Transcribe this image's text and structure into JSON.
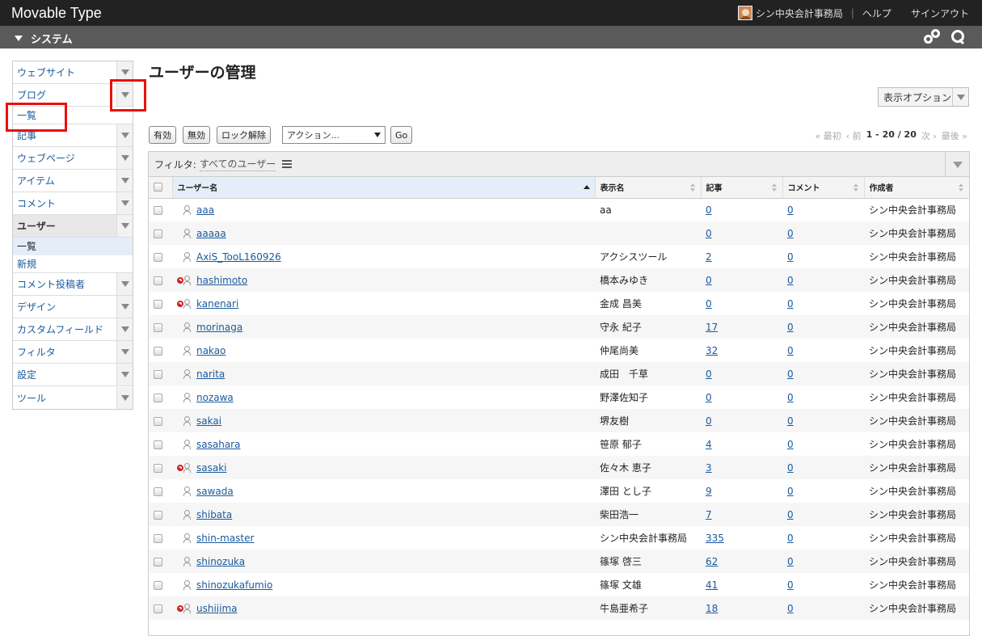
{
  "app": {
    "brand": "Movable Type"
  },
  "topnav": {
    "user": "シン中央会計事務局",
    "help": "ヘルプ",
    "signout": "サインアウト"
  },
  "scope": {
    "label": "システム"
  },
  "sidebar": {
    "items": [
      {
        "label": "ウェブサイト"
      },
      {
        "label": "ブログ"
      },
      {
        "label": "一覧"
      },
      {
        "label": "記事"
      },
      {
        "label": "ウェブページ"
      },
      {
        "label": "アイテム"
      },
      {
        "label": "コメント"
      },
      {
        "label": "ユーザー"
      },
      {
        "label": "一覧"
      },
      {
        "label": "新規"
      },
      {
        "label": "コメント投稿者"
      },
      {
        "label": "デザイン"
      },
      {
        "label": "カスタムフィールド"
      },
      {
        "label": "フィルタ"
      },
      {
        "label": "設定"
      },
      {
        "label": "ツール"
      }
    ]
  },
  "page": {
    "title": "ユーザーの管理",
    "display_options": "表示オプション"
  },
  "actions": {
    "enable": "有効",
    "disable": "無効",
    "unlock": "ロック解除",
    "action_select": "アクション...",
    "go": "Go"
  },
  "pager": {
    "first": "« 最初",
    "prev": "‹ 前",
    "range": "1 - 20 / 20",
    "next": "次 ›",
    "last": "最後 »"
  },
  "filter": {
    "label": "フィルタ:",
    "value": "すべてのユーザー"
  },
  "table": {
    "headers": {
      "username": "ユーザー名",
      "display": "表示名",
      "entries": "記事",
      "comments": "コメント",
      "author": "作成者"
    },
    "rows": [
      {
        "user": "aaa",
        "display": "aa",
        "entries": "0",
        "comments": "0",
        "author": "シン中央会計事務局",
        "disabled": false
      },
      {
        "user": "aaaaa",
        "display": "",
        "entries": "0",
        "comments": "0",
        "author": "シン中央会計事務局",
        "disabled": false
      },
      {
        "user": "AxiS_TooL160926",
        "display": "アクシスツール",
        "entries": "2",
        "comments": "0",
        "author": "シン中央会計事務局",
        "disabled": false
      },
      {
        "user": "hashimoto",
        "display": "橋本みゆき",
        "entries": "0",
        "comments": "0",
        "author": "シン中央会計事務局",
        "disabled": true
      },
      {
        "user": "kanenari",
        "display": "金成 昌美",
        "entries": "0",
        "comments": "0",
        "author": "シン中央会計事務局",
        "disabled": true
      },
      {
        "user": "morinaga",
        "display": "守永 紀子",
        "entries": "17",
        "comments": "0",
        "author": "シン中央会計事務局",
        "disabled": false
      },
      {
        "user": "nakao",
        "display": "仲尾尚美",
        "entries": "32",
        "comments": "0",
        "author": "シン中央会計事務局",
        "disabled": false
      },
      {
        "user": "narita",
        "display": "成田　千草",
        "entries": "0",
        "comments": "0",
        "author": "シン中央会計事務局",
        "disabled": false
      },
      {
        "user": "nozawa",
        "display": "野澤佐知子",
        "entries": "0",
        "comments": "0",
        "author": "シン中央会計事務局",
        "disabled": false
      },
      {
        "user": "sakai",
        "display": "堺友樹",
        "entries": "0",
        "comments": "0",
        "author": "シン中央会計事務局",
        "disabled": false
      },
      {
        "user": "sasahara",
        "display": "笹原 郁子",
        "entries": "4",
        "comments": "0",
        "author": "シン中央会計事務局",
        "disabled": false
      },
      {
        "user": "sasaki",
        "display": "佐々木 恵子",
        "entries": "3",
        "comments": "0",
        "author": "シン中央会計事務局",
        "disabled": true
      },
      {
        "user": "sawada",
        "display": "澤田 とし子",
        "entries": "9",
        "comments": "0",
        "author": "シン中央会計事務局",
        "disabled": false
      },
      {
        "user": "shibata",
        "display": "柴田浩一",
        "entries": "7",
        "comments": "0",
        "author": "シン中央会計事務局",
        "disabled": false
      },
      {
        "user": "shin-master",
        "display": "シン中央会計事務局",
        "entries": "335",
        "comments": "0",
        "author": "シン中央会計事務局",
        "disabled": false
      },
      {
        "user": "shinozuka",
        "display": "篠塚 啓三",
        "entries": "62",
        "comments": "0",
        "author": "シン中央会計事務局",
        "disabled": false
      },
      {
        "user": "shinozukafumio",
        "display": "篠塚 文雄",
        "entries": "41",
        "comments": "0",
        "author": "シン中央会計事務局",
        "disabled": false
      },
      {
        "user": "ushijima",
        "display": "牛島亜希子",
        "entries": "18",
        "comments": "0",
        "author": "シン中央会計事務局",
        "disabled": true
      }
    ]
  }
}
